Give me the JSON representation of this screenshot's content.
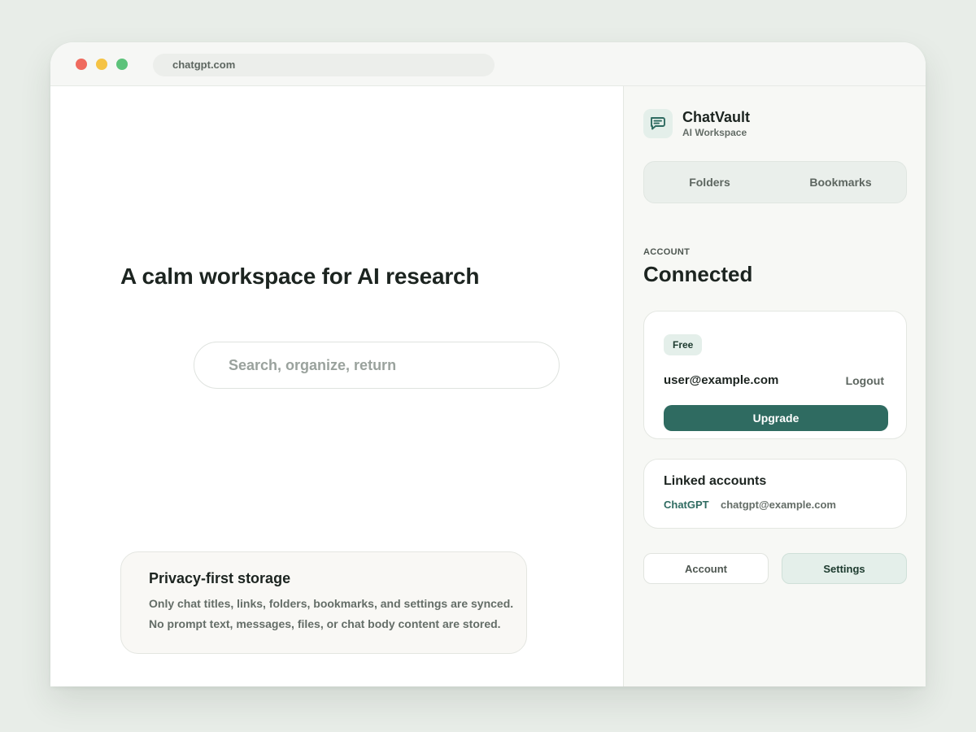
{
  "browser": {
    "url": "chatgpt.com"
  },
  "main": {
    "hero_title": "A calm workspace for AI research",
    "search_placeholder": "Search, organize, return",
    "privacy": {
      "title": "Privacy-first storage",
      "line1": "Only chat titles, links, folders, bookmarks, and settings are synced.",
      "line2": "No prompt text, messages, files, or chat body content are stored."
    }
  },
  "sidebar": {
    "brand_name": "ChatVault",
    "brand_subtitle": "AI Workspace",
    "brand_icon": "chat-bubble-icon",
    "tabs": [
      {
        "label": "Folders"
      },
      {
        "label": "Bookmarks"
      }
    ],
    "account_section_label": "ACCOUNT",
    "account_status": "Connected",
    "account_card": {
      "plan": "Free",
      "email": "user@example.com",
      "logout_label": "Logout",
      "upgrade_label": "Upgrade"
    },
    "linked": {
      "title": "Linked accounts",
      "service": "ChatGPT",
      "email": "chatgpt@example.com"
    },
    "footer": {
      "account_label": "Account",
      "settings_label": "Settings"
    }
  },
  "colors": {
    "accent": "#2f6b61",
    "accent_light": "#e4efea",
    "background": "#e8ede8"
  }
}
